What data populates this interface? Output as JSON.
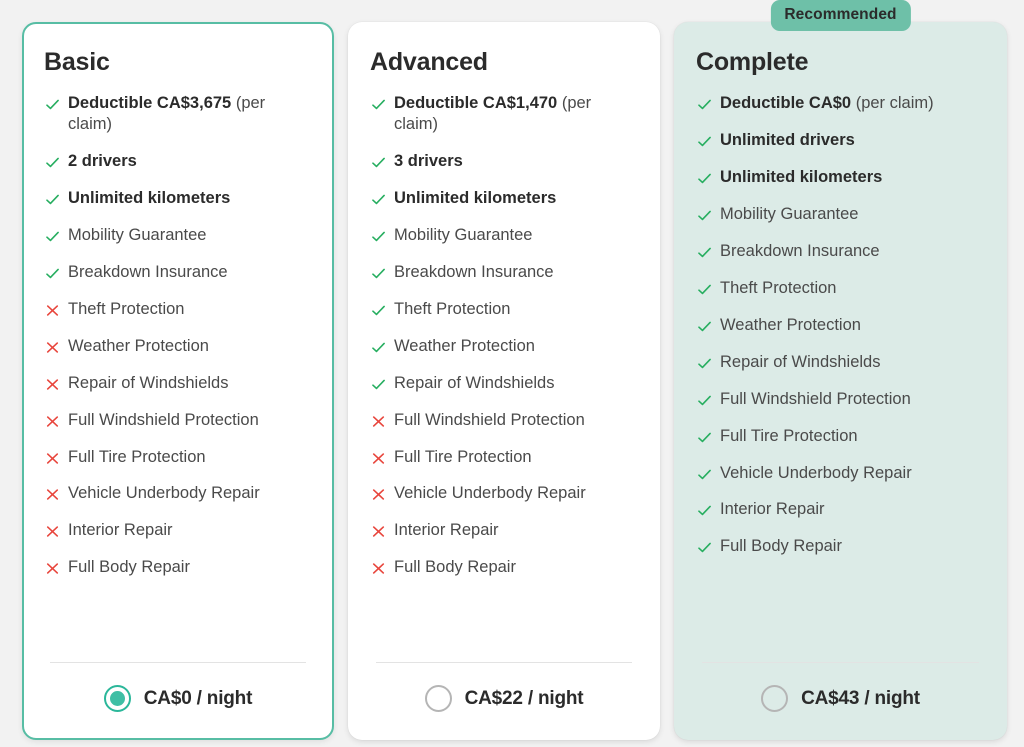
{
  "colors": {
    "page_background": "#f2f2f2",
    "accent_teal": "#3fbfa5",
    "selected_border": "#57bda4",
    "badge_background": "#6ec0a8",
    "recommended_card_background": "#dcebe7",
    "check_green": "#27ae60",
    "cross_red": "#e8453c",
    "text_dark": "#2b2b2b",
    "text_muted": "#4a4a4a"
  },
  "icons": {
    "included": "check-icon",
    "excluded": "cross-icon",
    "radio_selected": "radio-selected-icon",
    "radio_unselected": "radio-unselected-icon"
  },
  "plans": [
    {
      "id": "basic",
      "title": "Basic",
      "selected": true,
      "recommended": false,
      "badge": null,
      "price": "CA$0 / night",
      "price_currency": "CA$",
      "price_amount": 0,
      "price_period": "night",
      "features": [
        {
          "label_bold": "Deductible CA$3,675",
          "label_rest": " (per claim)",
          "included": true,
          "emphasis": "mixed"
        },
        {
          "label_bold": "2 drivers",
          "label_rest": "",
          "included": true,
          "emphasis": "strong"
        },
        {
          "label_bold": "Unlimited kilometers",
          "label_rest": "",
          "included": true,
          "emphasis": "strong"
        },
        {
          "label_bold": "",
          "label_rest": "Mobility Guarantee",
          "included": true,
          "emphasis": "normal"
        },
        {
          "label_bold": "",
          "label_rest": "Breakdown Insurance",
          "included": true,
          "emphasis": "normal"
        },
        {
          "label_bold": "",
          "label_rest": "Theft Protection",
          "included": false,
          "emphasis": "normal"
        },
        {
          "label_bold": "",
          "label_rest": "Weather Protection",
          "included": false,
          "emphasis": "normal"
        },
        {
          "label_bold": "",
          "label_rest": "Repair of Windshields",
          "included": false,
          "emphasis": "normal"
        },
        {
          "label_bold": "",
          "label_rest": "Full Windshield Protection",
          "included": false,
          "emphasis": "normal"
        },
        {
          "label_bold": "",
          "label_rest": "Full Tire Protection",
          "included": false,
          "emphasis": "normal"
        },
        {
          "label_bold": "",
          "label_rest": "Vehicle Underbody Repair",
          "included": false,
          "emphasis": "normal"
        },
        {
          "label_bold": "",
          "label_rest": "Interior Repair",
          "included": false,
          "emphasis": "normal"
        },
        {
          "label_bold": "",
          "label_rest": "Full Body Repair",
          "included": false,
          "emphasis": "normal"
        }
      ]
    },
    {
      "id": "advanced",
      "title": "Advanced",
      "selected": false,
      "recommended": false,
      "badge": null,
      "price": "CA$22 / night",
      "price_currency": "CA$",
      "price_amount": 22,
      "price_period": "night",
      "features": [
        {
          "label_bold": "Deductible CA$1,470",
          "label_rest": " (per claim)",
          "included": true,
          "emphasis": "mixed"
        },
        {
          "label_bold": "3 drivers",
          "label_rest": "",
          "included": true,
          "emphasis": "strong"
        },
        {
          "label_bold": "Unlimited kilometers",
          "label_rest": "",
          "included": true,
          "emphasis": "strong"
        },
        {
          "label_bold": "",
          "label_rest": "Mobility Guarantee",
          "included": true,
          "emphasis": "normal"
        },
        {
          "label_bold": "",
          "label_rest": "Breakdown Insurance",
          "included": true,
          "emphasis": "normal"
        },
        {
          "label_bold": "",
          "label_rest": "Theft Protection",
          "included": true,
          "emphasis": "normal"
        },
        {
          "label_bold": "",
          "label_rest": "Weather Protection",
          "included": true,
          "emphasis": "normal"
        },
        {
          "label_bold": "",
          "label_rest": "Repair of Windshields",
          "included": true,
          "emphasis": "normal"
        },
        {
          "label_bold": "",
          "label_rest": "Full Windshield Protection",
          "included": false,
          "emphasis": "normal"
        },
        {
          "label_bold": "",
          "label_rest": "Full Tire Protection",
          "included": false,
          "emphasis": "normal"
        },
        {
          "label_bold": "",
          "label_rest": "Vehicle Underbody Repair",
          "included": false,
          "emphasis": "normal"
        },
        {
          "label_bold": "",
          "label_rest": "Interior Repair",
          "included": false,
          "emphasis": "normal"
        },
        {
          "label_bold": "",
          "label_rest": "Full Body Repair",
          "included": false,
          "emphasis": "normal"
        }
      ]
    },
    {
      "id": "complete",
      "title": "Complete",
      "selected": false,
      "recommended": true,
      "badge": "Recommended",
      "price": "CA$43 / night",
      "price_currency": "CA$",
      "price_amount": 43,
      "price_period": "night",
      "features": [
        {
          "label_bold": "Deductible CA$0",
          "label_rest": " (per claim)",
          "included": true,
          "emphasis": "mixed"
        },
        {
          "label_bold": "Unlimited drivers",
          "label_rest": "",
          "included": true,
          "emphasis": "strong"
        },
        {
          "label_bold": "Unlimited kilometers",
          "label_rest": "",
          "included": true,
          "emphasis": "strong"
        },
        {
          "label_bold": "",
          "label_rest": "Mobility Guarantee",
          "included": true,
          "emphasis": "normal"
        },
        {
          "label_bold": "",
          "label_rest": "Breakdown Insurance",
          "included": true,
          "emphasis": "normal"
        },
        {
          "label_bold": "",
          "label_rest": "Theft Protection",
          "included": true,
          "emphasis": "normal"
        },
        {
          "label_bold": "",
          "label_rest": "Weather Protection",
          "included": true,
          "emphasis": "normal"
        },
        {
          "label_bold": "",
          "label_rest": "Repair of Windshields",
          "included": true,
          "emphasis": "normal"
        },
        {
          "label_bold": "",
          "label_rest": "Full Windshield Protection",
          "included": true,
          "emphasis": "normal"
        },
        {
          "label_bold": "",
          "label_rest": "Full Tire Protection",
          "included": true,
          "emphasis": "normal"
        },
        {
          "label_bold": "",
          "label_rest": "Vehicle Underbody Repair",
          "included": true,
          "emphasis": "normal"
        },
        {
          "label_bold": "",
          "label_rest": "Interior Repair",
          "included": true,
          "emphasis": "normal"
        },
        {
          "label_bold": "",
          "label_rest": "Full Body Repair",
          "included": true,
          "emphasis": "normal"
        }
      ]
    }
  ]
}
